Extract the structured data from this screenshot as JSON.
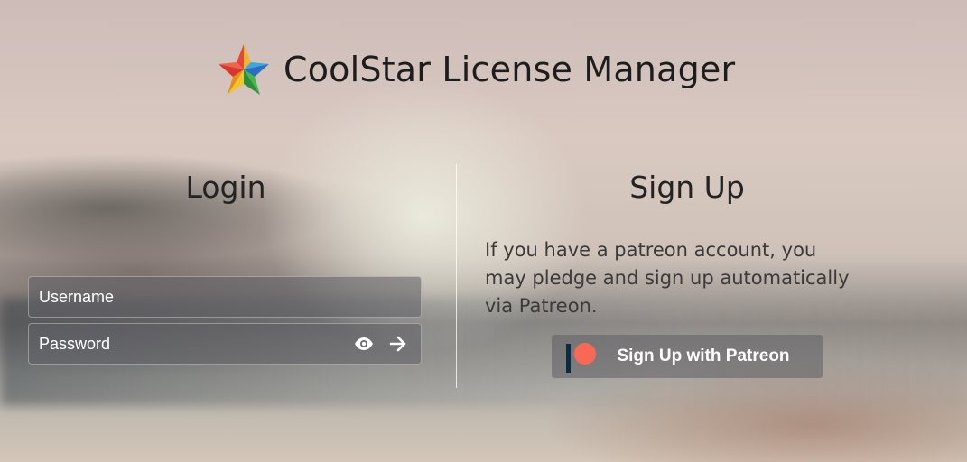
{
  "app": {
    "title": "CoolStar License Manager",
    "logo_icon": "star-logo-icon"
  },
  "login": {
    "title": "Login",
    "username_placeholder": "Username",
    "password_placeholder": "Password",
    "reveal_icon": "eye-icon",
    "submit_icon": "arrow-right-icon"
  },
  "signup": {
    "title": "Sign Up",
    "description": "If you have a patreon account, you may pledge and sign up automatically via Patreon.",
    "button_label": "Sign Up with Patreon",
    "button_icon": "patreon-icon"
  },
  "colors": {
    "patreon_red": "#f96854",
    "patreon_navy": "#052d49"
  }
}
